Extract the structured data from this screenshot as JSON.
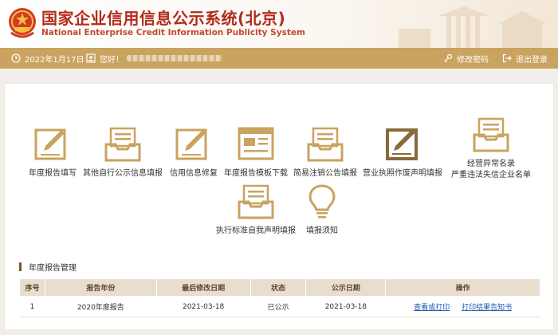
{
  "header": {
    "title_cn": "国家企业信用信息公示系统(北京)",
    "title_en": "National Enterprise Credit Information Publicity System",
    "brand_color": "#b32b1c"
  },
  "toolbar": {
    "date": "2022年1月17日",
    "greeting": "您好！",
    "change_password": "修改密码",
    "logout": "退出登录",
    "bg_color": "#c9a35f"
  },
  "tiles": [
    {
      "label": "年度报告填写",
      "icon": "pencil-document-icon"
    },
    {
      "label": "其他自行公示信息填报",
      "icon": "inbox-tray-icon"
    },
    {
      "label": "信用信息修复",
      "icon": "pencil-document-icon"
    },
    {
      "label": "年度报告模板下载",
      "icon": "template-window-icon"
    },
    {
      "label": "简易注销公告填报",
      "icon": "inbox-tray-icon"
    },
    {
      "label": "营业执照作废声明填报",
      "icon": "edit-box-icon"
    },
    {
      "label_line1": "经营异常名录",
      "label_line2": "严重违法失信企业名单",
      "icon": "inbox-tray-icon"
    },
    {
      "label": "执行标准自我声明填报",
      "icon": "inbox-tray-icon"
    },
    {
      "label": "填报须知",
      "icon": "lightbulb-icon"
    }
  ],
  "icon_color": "#c9a35f",
  "section": {
    "title": "年度报告管理"
  },
  "table": {
    "headers": [
      "序号",
      "报告年份",
      "最后修改日期",
      "状态",
      "公示日期",
      "操作"
    ],
    "rows": [
      {
        "no": "1",
        "year": "2020年度报告",
        "modified": "2021-03-18",
        "status": "已公示",
        "published": "2021-03-18",
        "action_view_print": "查看或打印",
        "action_print_notice": "打印结果告知书"
      }
    ]
  }
}
